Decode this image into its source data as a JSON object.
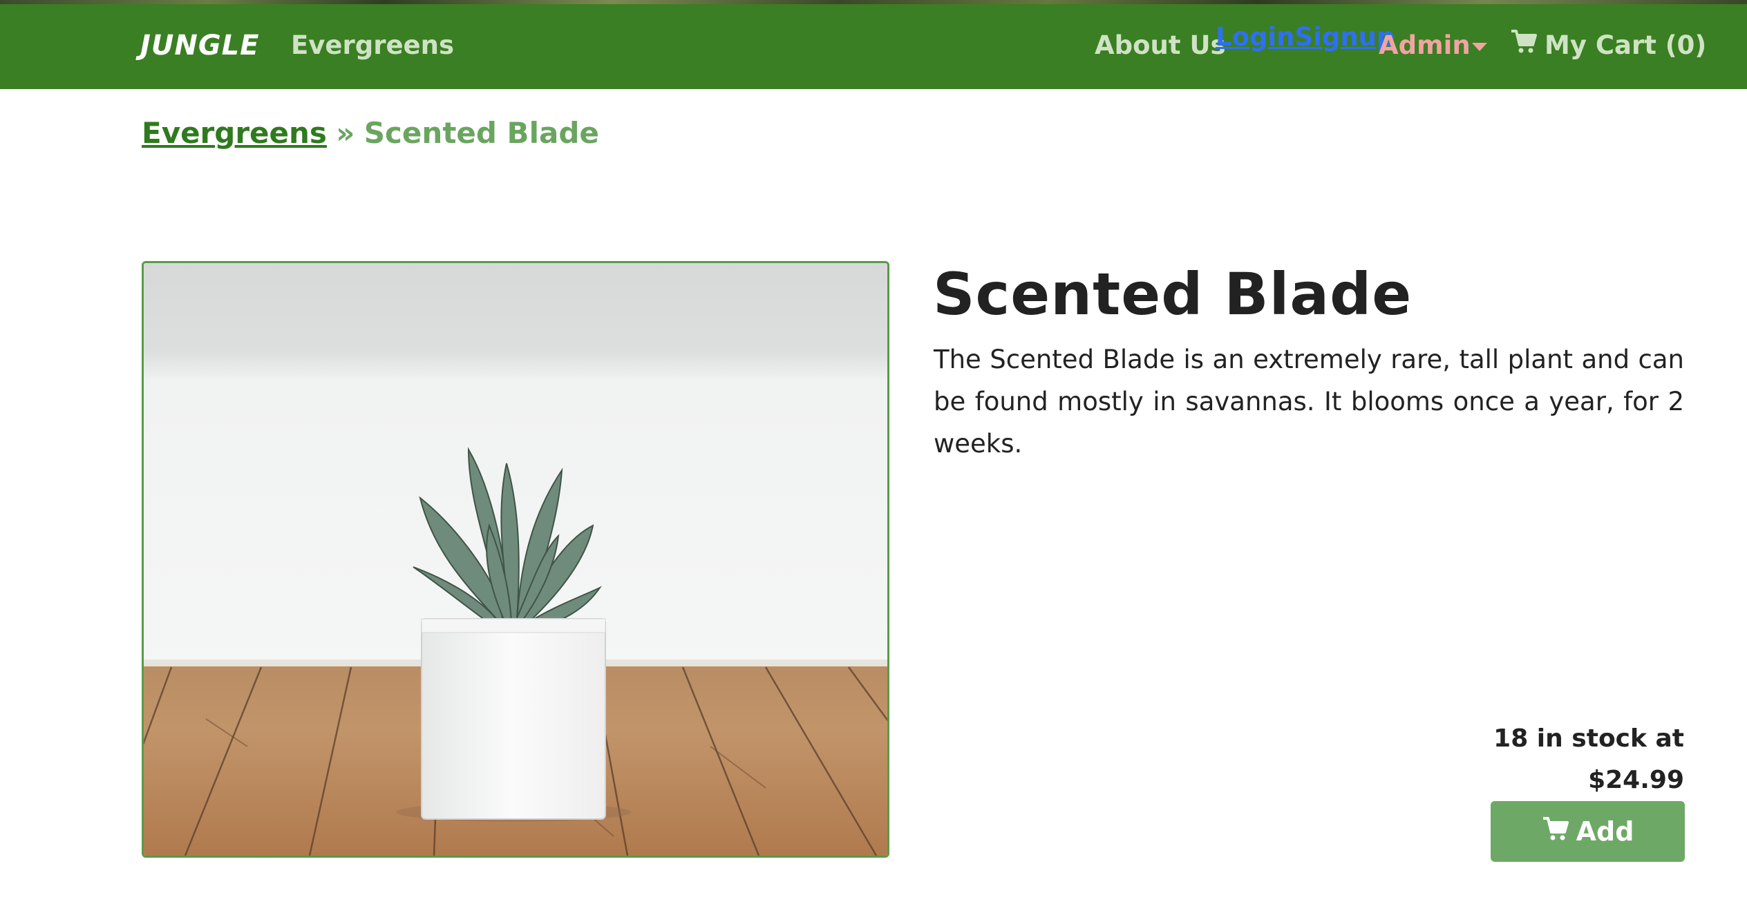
{
  "navbar": {
    "brand": "JUNGLE",
    "category_link": "Evergreens",
    "about_link": "About Us",
    "auth_link": "LoginSignup",
    "admin_menu": "Admin",
    "cart_label": "My Cart (0)"
  },
  "breadcrumb": {
    "parent": "Evergreens",
    "separator": "»",
    "current": "Scented Blade"
  },
  "product": {
    "title": "Scented Blade",
    "description": "The Scented Blade is an extremely rare, tall plant and can be found mostly in savannas. It blooms once a year, for 2 weeks.",
    "stock_line": "18 in stock at",
    "price": "$24.99",
    "add_button": "Add"
  },
  "icons": {
    "cart": "cart-icon",
    "dropdown": "caret-down-icon"
  },
  "colors": {
    "navbar": "#3a7f23",
    "accent": "#6ea866",
    "link": "#2f7a1f",
    "admin": "#f2a3a3",
    "auth_link": "#2f6ff0"
  }
}
